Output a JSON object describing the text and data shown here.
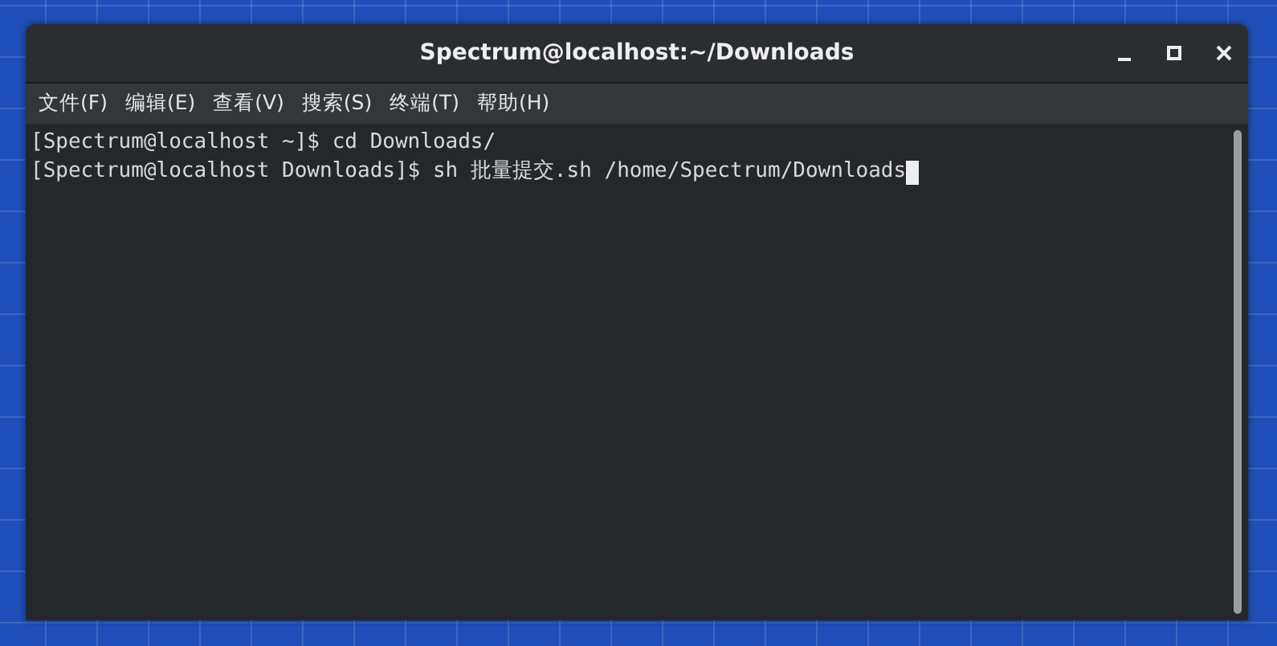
{
  "window": {
    "title": "Spectrum@localhost:~/Downloads"
  },
  "menu": [
    "文件(F)",
    "编辑(E)",
    "查看(V)",
    "搜索(S)",
    "终端(T)",
    "帮助(H)"
  ],
  "terminal": {
    "lines": [
      "[Spectrum@localhost ~]$ cd Downloads/",
      "[Spectrum@localhost Downloads]$ sh 批量提交.sh /home/Spectrum/Downloads"
    ]
  }
}
